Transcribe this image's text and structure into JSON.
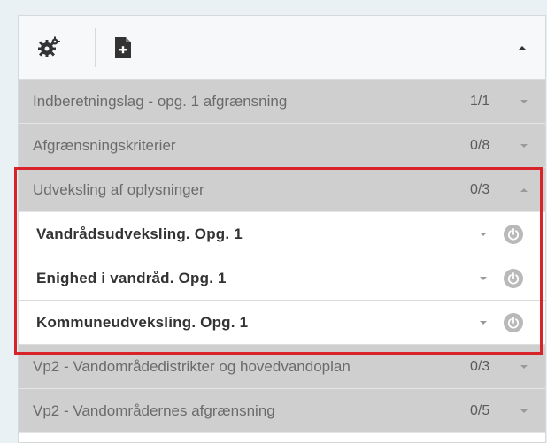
{
  "toolbar": {
    "icons": [
      "settings-gear-icon",
      "add-document-icon"
    ],
    "collapse_icon": "chevron-up-icon"
  },
  "layers": [
    {
      "label": "Indberetningslag - opg. 1 afgrænsning",
      "count": "1/1",
      "expanded": false
    },
    {
      "label": "Afgrænsningskriterier",
      "count": "0/8",
      "expanded": false
    },
    {
      "label": "Udveksling af oplysninger",
      "count": "0/3",
      "expanded": true,
      "items": [
        {
          "label": "Vandrådsudveksling. Opg. 1"
        },
        {
          "label": "Enighed i vandråd. Opg. 1"
        },
        {
          "label": "Kommuneudveksling. Opg. 1"
        }
      ]
    },
    {
      "label": "Vp2 - Vandområdedistrikter og hovedvandoplan",
      "count": "0/3",
      "expanded": false
    },
    {
      "label": "Vp2 - Vandområdernes afgrænsning",
      "count": "0/5",
      "expanded": false
    }
  ],
  "colors": {
    "highlight_border": "#d8232a",
    "layer_header_bg": "#cfcfcf",
    "power_icon_bg": "#b9b9b9"
  }
}
